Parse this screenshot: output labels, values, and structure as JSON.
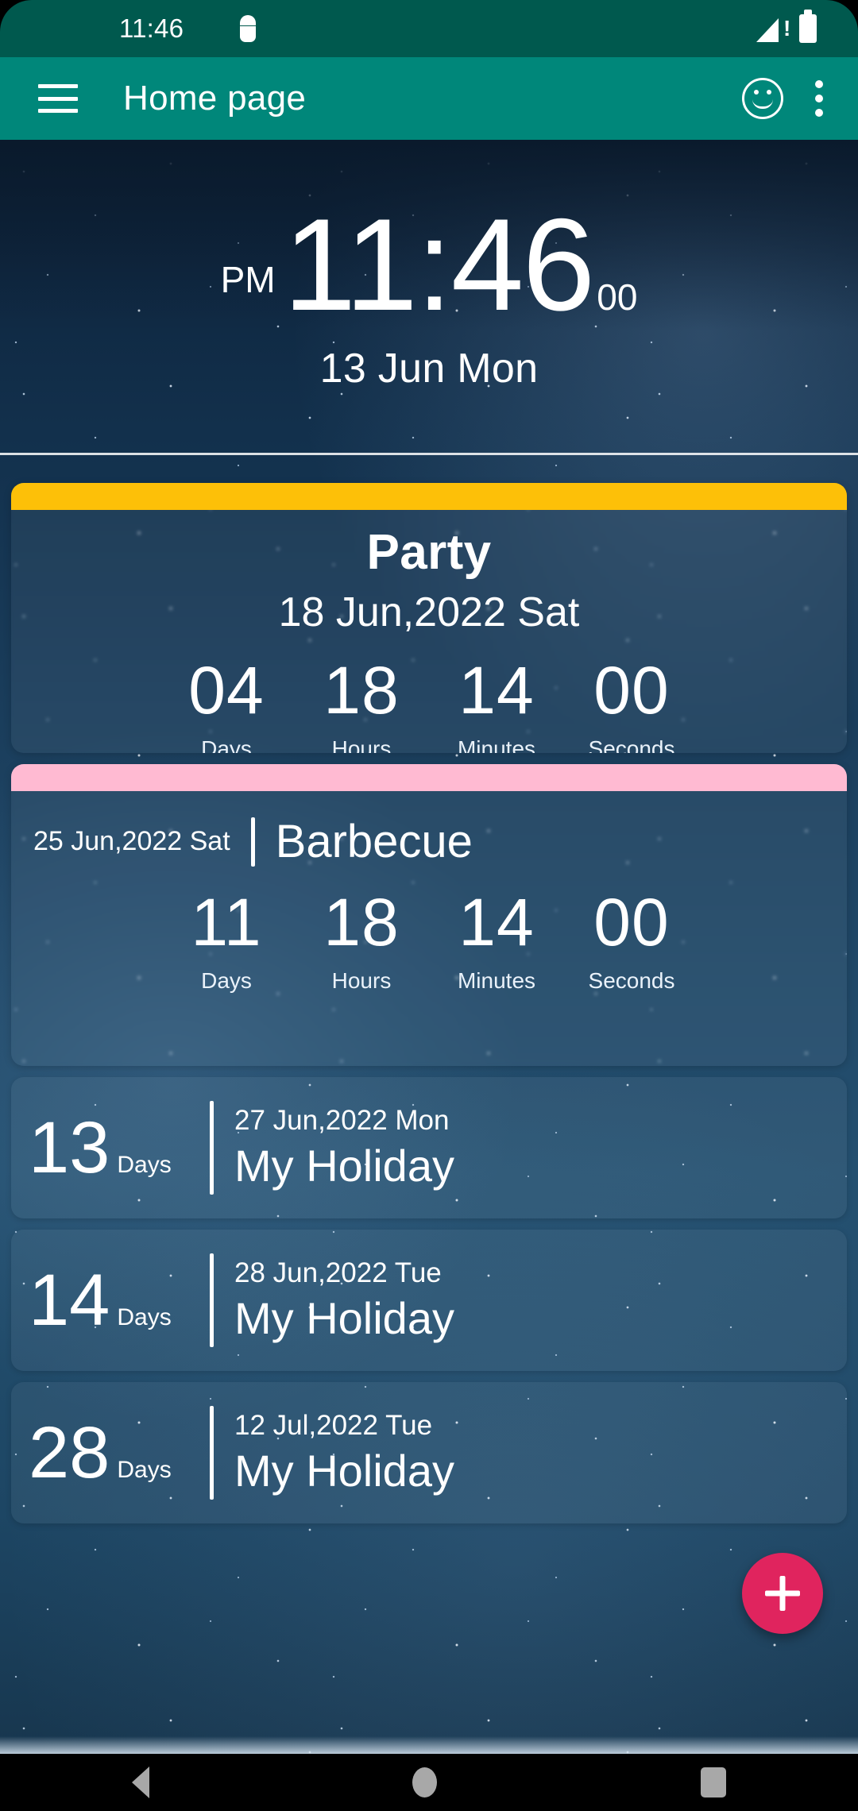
{
  "statusbar": {
    "time": "11:46",
    "icons": [
      "android-debug-icon",
      "signal-no-sim-icon",
      "battery-full-icon"
    ]
  },
  "appbar": {
    "title": "Home page",
    "menu_icon": "hamburger-menu-icon",
    "smiley_icon": "smiley-face-icon",
    "overflow_icon": "kebab-menu-icon"
  },
  "clock": {
    "ampm": "PM",
    "time": "11:46",
    "seconds": "00",
    "date": "13 Jun Mon"
  },
  "featured": [
    {
      "accent_color": "#FDC008",
      "title": "Party",
      "date": "18 Jun,2022 Sat",
      "countdown": [
        {
          "value": "04",
          "label": "Days"
        },
        {
          "value": "18",
          "label": "Hours"
        },
        {
          "value": "14",
          "label": "Minutes"
        },
        {
          "value": "00",
          "label": "Seconds"
        }
      ]
    },
    {
      "accent_color": "#FFBAD2",
      "title": "Barbecue",
      "date": "25 Jun,2022 Sat",
      "countdown": [
        {
          "value": "11",
          "label": "Days"
        },
        {
          "value": "18",
          "label": "Hours"
        },
        {
          "value": "14",
          "label": "Minutes"
        },
        {
          "value": "00",
          "label": "Seconds"
        }
      ]
    }
  ],
  "events": [
    {
      "days": "13",
      "days_label": "Days",
      "date": "27 Jun,2022 Mon",
      "name": "My Holiday"
    },
    {
      "days": "14",
      "days_label": "Days",
      "date": "28 Jun,2022 Tue",
      "name": "My Holiday"
    },
    {
      "days": "28",
      "days_label": "Days",
      "date": "12 Jul,2022 Tue",
      "name": "My Holiday"
    }
  ],
  "fab": {
    "icon": "plus-icon",
    "color": "#E0245E"
  },
  "navbar": {
    "back": "back-icon",
    "home": "home-icon",
    "recents": "recents-icon"
  },
  "theme": {
    "statusbar_color": "#00594e",
    "appbar_color": "#00877a",
    "accent_amber": "#FDC008",
    "accent_pink": "#FFBAD2",
    "fab_color": "#E0245E"
  }
}
